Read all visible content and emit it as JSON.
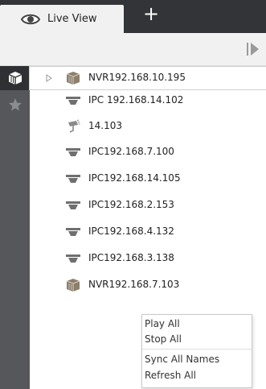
{
  "tab": {
    "live_view_label": "Live View",
    "icon": "eye-icon"
  },
  "add_tab": {
    "label": "+"
  },
  "toolbar": {
    "collapse_icon": "collapse-panel-icon"
  },
  "leftnav": {
    "items": [
      {
        "icon": "cube-devices-icon",
        "active": true
      },
      {
        "icon": "star-icon",
        "active": false
      }
    ]
  },
  "tree": {
    "items": [
      {
        "label": "NVR192.168.10.195",
        "type": "nvr",
        "expandable": true,
        "selected": true
      },
      {
        "label": "IPC 192.168.14.102",
        "type": "dome"
      },
      {
        "label": "14.103",
        "type": "ptz"
      },
      {
        "label": "IPC192.168.7.100",
        "type": "dome"
      },
      {
        "label": "IPC192.168.14.105",
        "type": "dome"
      },
      {
        "label": "IPC192.168.2.153",
        "type": "dome"
      },
      {
        "label": "IPC192.168.4.132",
        "type": "dome"
      },
      {
        "label": "IPC192.168.3.138",
        "type": "dome"
      },
      {
        "label": "NVR192.168.7.103",
        "type": "nvr"
      }
    ]
  },
  "context_menu": {
    "play_all": "Play All",
    "stop_all": "Stop All",
    "sync_all_names": "Sync All Names",
    "refresh_all": "Refresh All"
  },
  "colors": {
    "tabbar": "#333438",
    "leftnav": "#55575b",
    "leftnav_active": "#2f3033",
    "toolbar": "#f1f1f1"
  }
}
